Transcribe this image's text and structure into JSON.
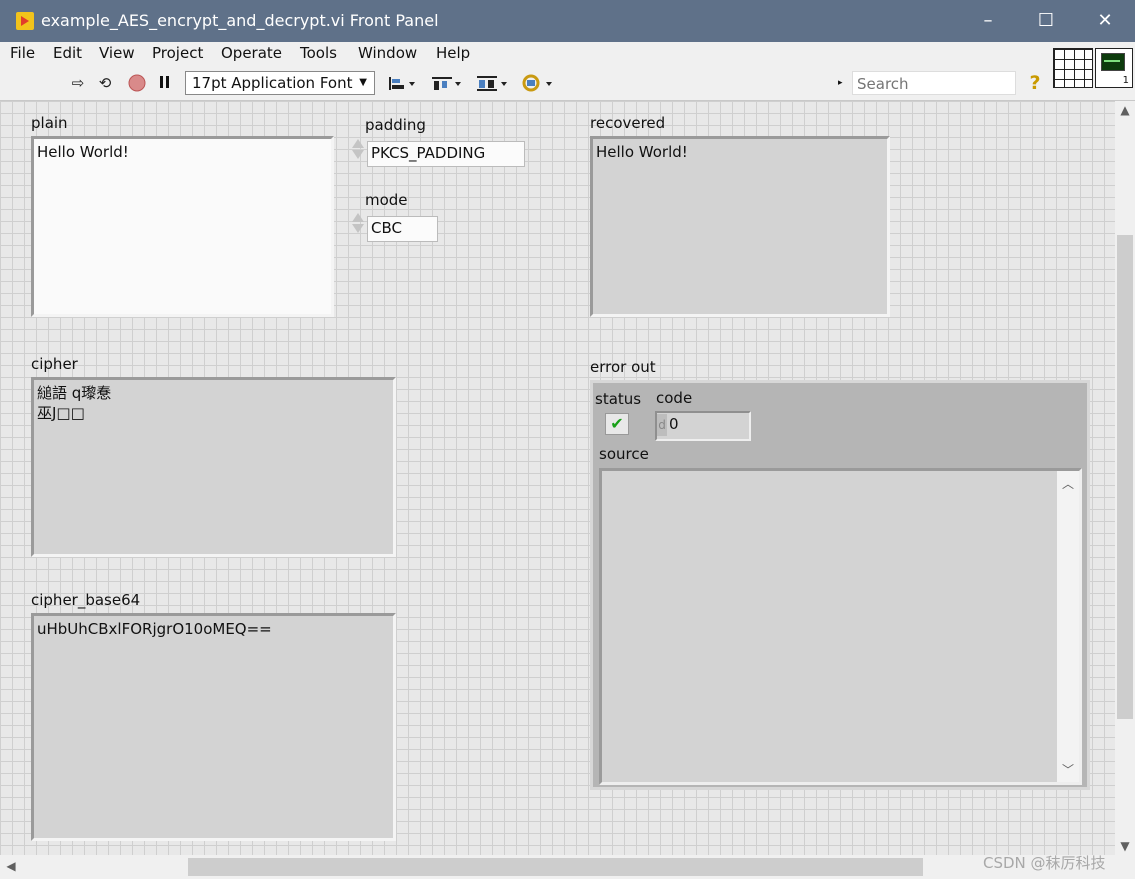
{
  "window": {
    "title": "example_AES_encrypt_and_decrypt.vi Front Panel",
    "minimize_glyph": "–",
    "maximize_glyph": "☐",
    "close_glyph": "✕"
  },
  "menu": [
    "File",
    "Edit",
    "View",
    "Project",
    "Operate",
    "Tools",
    "Window",
    "Help"
  ],
  "toolbar": {
    "font": "17pt Application Font",
    "search_placeholder": "Search",
    "icons": [
      "run-arrow-icon",
      "run-continuously-icon",
      "abort-icon",
      "pause-icon",
      "align-objects-icon",
      "distribute-objects-icon",
      "resize-objects-icon",
      "reorder-icon",
      "search-icon",
      "help-icon"
    ],
    "vi_icon_number": "1"
  },
  "controls": {
    "plain": {
      "label": "plain",
      "value": "Hello World!"
    },
    "padding": {
      "label": "padding",
      "value": "PKCS_PADDING"
    },
    "mode": {
      "label": "mode",
      "value": "CBC"
    },
    "recovered": {
      "label": "recovered",
      "value": "Hello World!"
    },
    "cipher": {
      "label": "cipher",
      "value": "縋語 q瓈惷\n巫J□□"
    },
    "cipher_base64": {
      "label": "cipher_base64",
      "value": "uHbUhCBxlFORjgrO10oMEQ=="
    },
    "error_out": {
      "label": "error out",
      "status_label": "status",
      "status_value": "✔",
      "code_label": "code",
      "code_radix": "d",
      "code_value": "0",
      "source_label": "source",
      "source_value": ""
    }
  },
  "watermark": "CSDN @秣厉科技",
  "colors": {
    "titlebar": "#5f7189",
    "panel_bg": "#e8e8e8",
    "grid": "#cfcfcf",
    "indicator_bg": "#d3d3d3",
    "status_ok": "#18a018"
  }
}
